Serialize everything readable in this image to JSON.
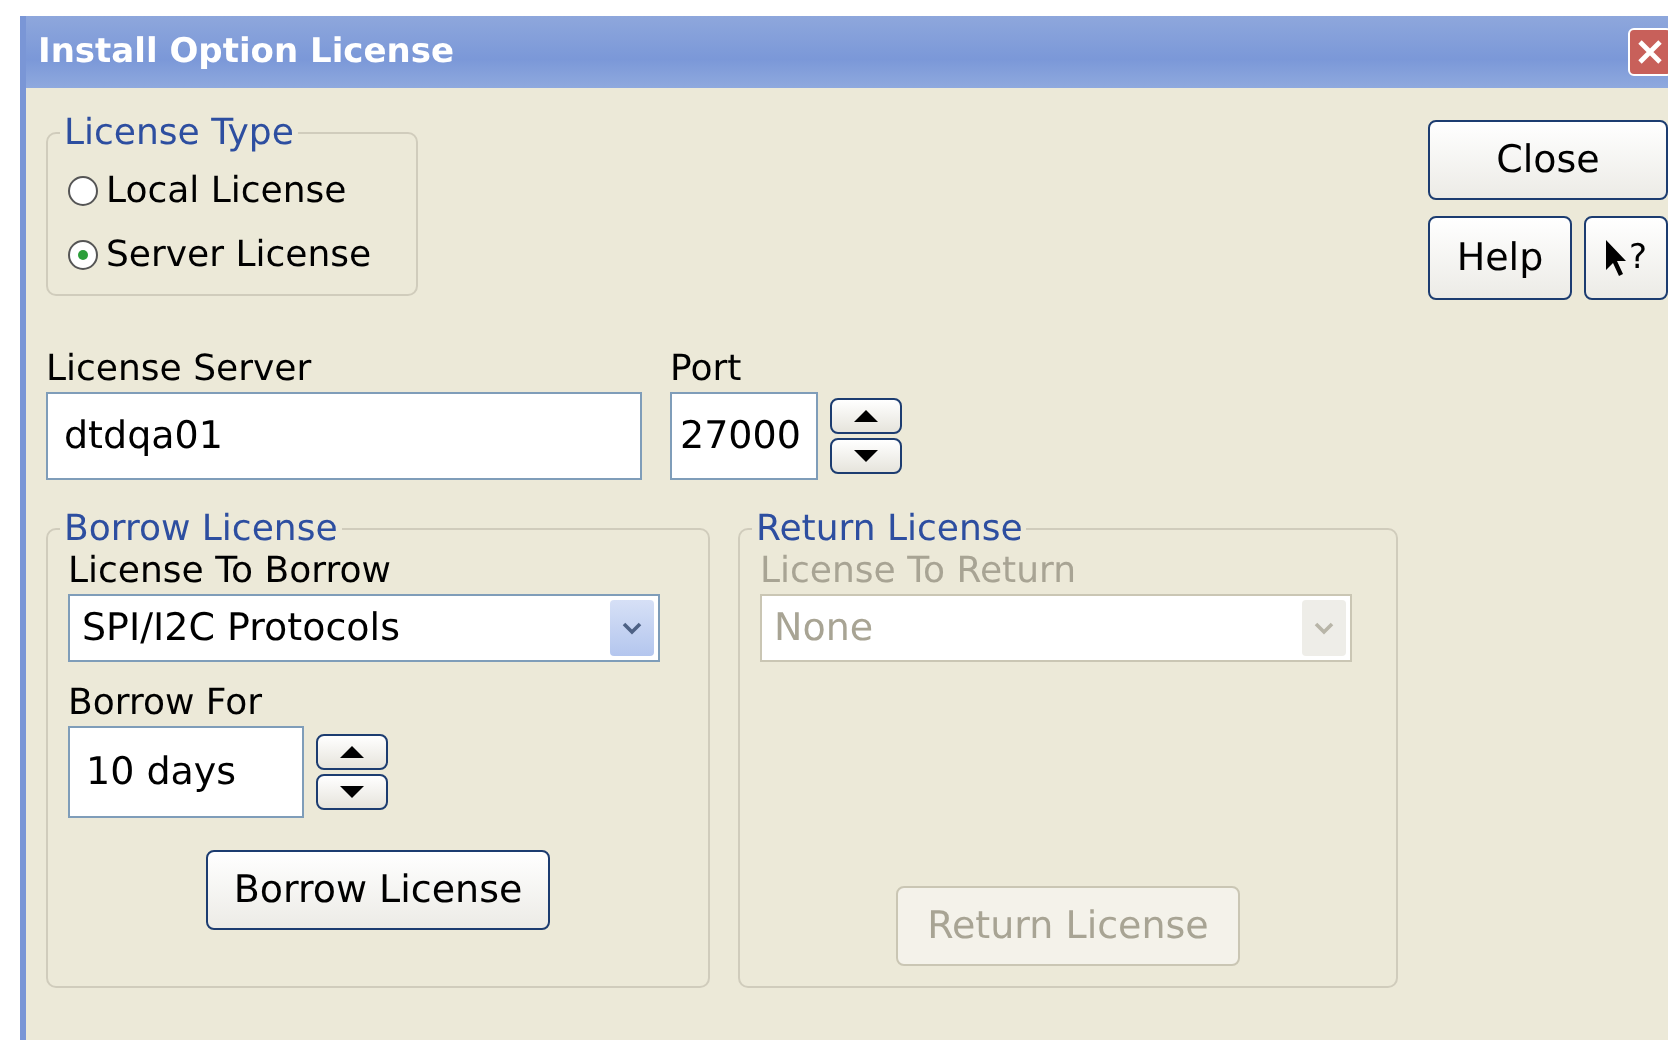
{
  "window": {
    "title": "Install Option License"
  },
  "license_type": {
    "title": "License Type",
    "options": [
      {
        "label": "Local License",
        "selected": false
      },
      {
        "label": "Server License",
        "selected": true
      }
    ]
  },
  "buttons": {
    "close": "Close",
    "help": "Help",
    "whats_this": "?"
  },
  "license_server": {
    "label": "License Server",
    "value": "dtdqa01"
  },
  "port": {
    "label": "Port",
    "value": "27000"
  },
  "borrow_license": {
    "title": "Borrow License",
    "disabled": false,
    "license_label": "License To Borrow",
    "license_value": "SPI/I2C Protocols",
    "for_label": "Borrow For",
    "for_value": "10 days",
    "button": "Borrow License"
  },
  "return_license": {
    "title": "Return License",
    "disabled": true,
    "license_label": "License To Return",
    "license_value": "None",
    "button": "Return License"
  }
}
